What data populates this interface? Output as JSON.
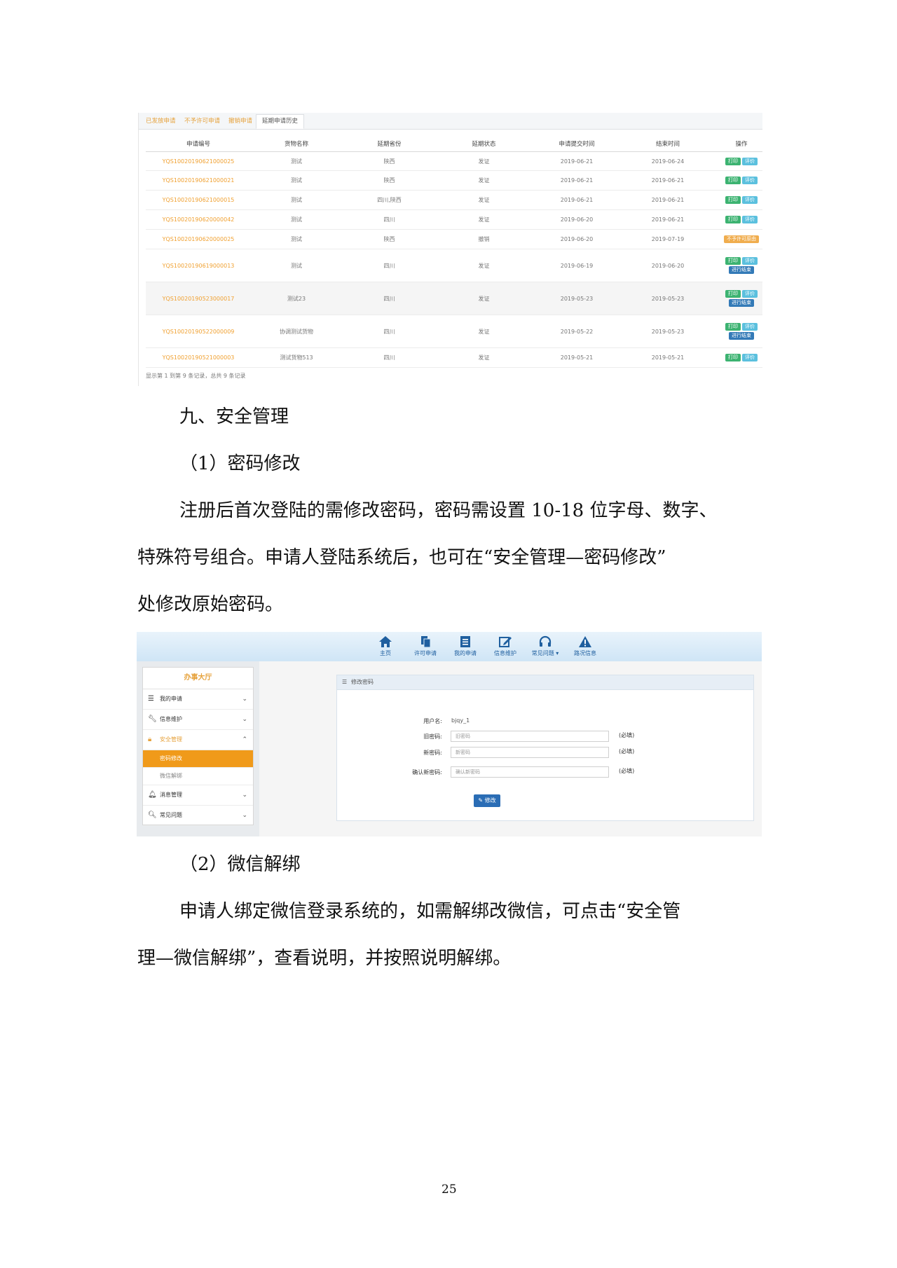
{
  "screenshot1": {
    "tabs": [
      "已发放申请",
      "不予许可申请",
      "撤销申请",
      "延期申请历史"
    ],
    "columns": [
      "申请编号",
      "货物名称",
      "延期省份",
      "延期状态",
      "申请提交时间",
      "结束时间",
      "操作"
    ],
    "rows": [
      {
        "id": "YQS10020190621000025",
        "goods": "测试",
        "province": "陕西",
        "status": "发证",
        "submitted": "2019-06-21",
        "end": "2019-06-24",
        "actions": [
          "打印",
          "评价"
        ]
      },
      {
        "id": "YQS10020190621000021",
        "goods": "测试",
        "province": "陕西",
        "status": "发证",
        "submitted": "2019-06-21",
        "end": "2019-06-21",
        "actions": [
          "打印",
          "评价"
        ]
      },
      {
        "id": "YQS10020190621000015",
        "goods": "测试",
        "province": "四川,陕西",
        "status": "发证",
        "submitted": "2019-06-21",
        "end": "2019-06-21",
        "actions": [
          "打印",
          "评价"
        ]
      },
      {
        "id": "YQS10020190620000042",
        "goods": "测试",
        "province": "四川",
        "status": "发证",
        "submitted": "2019-06-20",
        "end": "2019-06-21",
        "actions": [
          "打印",
          "评价"
        ]
      },
      {
        "id": "YQS10020190620000025",
        "goods": "测试",
        "province": "陕西",
        "status": "撤销",
        "submitted": "2019-06-20",
        "end": "2019-07-19",
        "actions": [
          "不予许可原由"
        ]
      },
      {
        "id": "YQS10020190619000013",
        "goods": "测试",
        "province": "四川",
        "status": "发证",
        "submitted": "2019-06-19",
        "end": "2019-06-20",
        "actions": [
          "打印",
          "评价",
          "进行结束"
        ]
      },
      {
        "id": "YQS10020190523000017",
        "goods": "测试23",
        "province": "四川",
        "status": "发证",
        "submitted": "2019-05-23",
        "end": "2019-05-23",
        "actions": [
          "打印",
          "评价",
          "进行结束"
        ]
      },
      {
        "id": "YQS10020190522000009",
        "goods": "协调测试货物",
        "province": "四川",
        "status": "发证",
        "submitted": "2019-05-22",
        "end": "2019-05-23",
        "actions": [
          "打印",
          "评价",
          "进行结束"
        ]
      },
      {
        "id": "YQS10020190521000003",
        "goods": "测试货物513",
        "province": "四川",
        "status": "发证",
        "submitted": "2019-05-21",
        "end": "2019-05-21",
        "actions": [
          "打印",
          "评价"
        ]
      }
    ],
    "summary": "显示第 1 到第 9 条记录，总共 9 条记录"
  },
  "section_heading": "九、安全管理",
  "sub1_heading": "（1）密码修改",
  "para1": {
    "line1": "注册后首次登陆的需修改密码，密码需设置 10-18 位字母、数字、",
    "line2": "特殊符号组合。申请人登陆系统后，也可在“安全管理—密码修改”",
    "line3": "处修改原始密码。"
  },
  "screenshot2": {
    "nav": [
      {
        "label": "主页",
        "icon": "home-icon"
      },
      {
        "label": "许可申请",
        "icon": "copy-icon"
      },
      {
        "label": "我的申请",
        "icon": "list-icon"
      },
      {
        "label": "信息维护",
        "icon": "edit-icon"
      },
      {
        "label": "常见问题 ▾",
        "icon": "headphones-icon"
      },
      {
        "label": "路况信息",
        "icon": "warning-icon"
      }
    ],
    "sidebar": {
      "title": "办事大厅",
      "items": [
        {
          "label": "我的申请",
          "icon": "list-icon"
        },
        {
          "label": "信息维护",
          "icon": "wrench-icon"
        },
        {
          "label": "安全管理",
          "icon": "lock-icon"
        },
        {
          "label": "消息管理",
          "icon": "bell-icon"
        },
        {
          "label": "常见问题",
          "icon": "search-icon"
        }
      ],
      "subitems": [
        "密码修改",
        "微信解绑"
      ]
    },
    "panel_title": "修改密码",
    "form": {
      "username_label": "用户名:",
      "username_value": "bjqy_1",
      "old_label": "旧密码:",
      "old_placeholder": "旧密码",
      "new_label": "新密码:",
      "new_placeholder": "新密码",
      "confirm_label": "确认新密码:",
      "confirm_placeholder": "确认新密码",
      "required": "(必填)",
      "submit": "修改"
    }
  },
  "sub2_heading": "（2）微信解绑",
  "para2": {
    "line1": "申请人绑定微信登录系统的，如需解绑改微信，可点击“安全管",
    "line2": "理—微信解绑”，查看说明，并按照说明解绑。"
  },
  "page_number": "25"
}
